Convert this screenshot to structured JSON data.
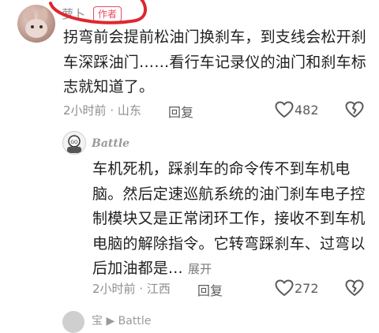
{
  "comment1": {
    "username": "萝卜",
    "badge": "作者",
    "text": "拐弯前会提前松油门换刹车，到支线会松开刹车深踩油门……看行车记录仪的油门和刹车标志就知道了。",
    "time": "2小时前",
    "location": "山东",
    "reply_label": "回复",
    "likes": "482"
  },
  "comment2": {
    "username": "Battle",
    "avatar_text": "GO",
    "text": "车机死机，踩刹车的命令传不到车机电脑。然后定速巡航系统的油门刹车电子控制模块又是正常闭环工作，接收不到车机电脑的解除指令。它转弯踩刹车、过弯以后加油都是...",
    "expand_label": "展开",
    "time": "2小时前",
    "location": "江西",
    "reply_label": "回复",
    "likes": "272"
  },
  "comment3": {
    "partial_text": "宝 ▶ Battle"
  },
  "colors": {
    "badge": "#e84a5f",
    "annotation_circle": "#e0262e",
    "meta_text": "#8e8e8e"
  },
  "icons": {
    "like": "heart-outline-icon",
    "dislike": "broken-heart-outline-icon"
  }
}
